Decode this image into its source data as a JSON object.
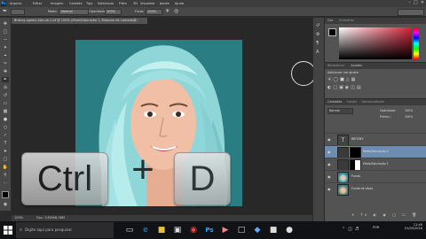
{
  "app": {
    "logo": "Ps"
  },
  "menu": [
    "Arquivo",
    "Editar",
    "Imagem",
    "Camada",
    "Tipo",
    "Selecionar",
    "Filtro",
    "3D",
    "Visualizar",
    "Janela",
    "Ajuda"
  ],
  "options": {
    "mode_label": "Modo:",
    "mode_value": "Normal",
    "opacity_label": "Opacidade:",
    "opacity_value": "100%",
    "flow_label": "Fluxo:",
    "flow_value": "100%"
  },
  "document": {
    "tab": "Britney-spears-hair-de-1.tif @ 100% (Nível/Saturação 1, Máscara de camada/8)"
  },
  "status": {
    "zoom": "100%",
    "doc": "Doc: 3,82M/8,56M"
  },
  "overlay": {
    "key1": "Ctrl",
    "plus": "+",
    "key2": "D"
  },
  "panels": {
    "color_tabs": [
      "Cor",
      "Amostras"
    ],
    "adjust_tabs": [
      "Bibliotecas",
      "Ajustes"
    ],
    "adjust_title": "Adicionar um ajuste",
    "layers_tabs": [
      "Camadas",
      "Canais",
      "Demarcadores"
    ],
    "layers_mode": "Normal",
    "layers_opacity_label": "Opacidade:",
    "layers_opacity": "100%",
    "layers_fill_label": "Preenc.:",
    "layers_fill": "100%"
  },
  "layers": [
    {
      "name": "BRITNEY",
      "thumb": "T",
      "selected": false
    },
    {
      "name": "Matiz/Saturação 2",
      "thumb": "adj",
      "selected": true
    },
    {
      "name": "Matiz/Saturação 1",
      "thumb": "adj",
      "selected": false
    },
    {
      "name": "Fundo",
      "thumb": "photo",
      "selected": false
    },
    {
      "name": "Fundo de cópia",
      "thumb": "photo",
      "selected": false
    }
  ],
  "taskbar": {
    "search_placeholder": "Digite aqui para pesquisar",
    "time": "11:40",
    "date": "01/05/2016",
    "lang": "POR"
  },
  "colors": {
    "accent": "#31a8ff",
    "selected_layer": "#6e8bb0",
    "canvas_bg": "#2b7d84",
    "fg_color": "#000000",
    "bg_color": "#ffffff"
  }
}
